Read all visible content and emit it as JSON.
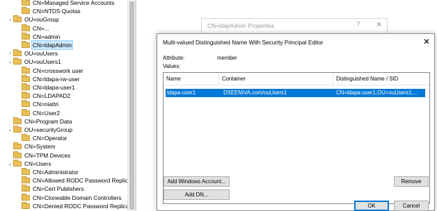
{
  "tree": {
    "nodes": [
      {
        "twisty": "",
        "label": "CN=Managed Service Accounts",
        "selected": false
      },
      {
        "twisty": "",
        "label": "CN=NTDS Quotas",
        "selected": false
      },
      {
        "twisty": "expanded",
        "label": "OU=ouGroup",
        "selected": false
      },
      {
        "twisty": "",
        "label": "CN=...",
        "selected": false
      },
      {
        "twisty": "",
        "label": "CN=admin",
        "selected": false
      },
      {
        "twisty": "",
        "label": "CN=ldapAdmin",
        "selected": true
      },
      {
        "twisty": "collapsed",
        "label": "OU=ouUsers",
        "selected": false
      },
      {
        "twisty": "expanded",
        "label": "OU=ouUsers1",
        "selected": false
      },
      {
        "twisty": "",
        "label": "CN=crosswork user",
        "selected": false
      },
      {
        "twisty": "",
        "label": "CN=ldapa-rw-user",
        "selected": false
      },
      {
        "twisty": "",
        "label": "CN=ldapa-user1",
        "selected": false
      },
      {
        "twisty": "",
        "label": "CN=LDAPAD2",
        "selected": false
      },
      {
        "twisty": "",
        "label": "CN=niattri",
        "selected": false
      },
      {
        "twisty": "",
        "label": "CN=User2",
        "selected": false
      },
      {
        "twisty": "",
        "label": "CN=Program Data",
        "selected": false
      },
      {
        "twisty": "expanded",
        "label": "OU=securityGroup",
        "selected": false
      },
      {
        "twisty": "",
        "label": "CN=Operator",
        "selected": false
      },
      {
        "twisty": "",
        "label": "CN=System",
        "selected": false
      },
      {
        "twisty": "",
        "label": "CN=TPM Devices",
        "selected": false
      },
      {
        "twisty": "expanded",
        "label": "CN=Users",
        "selected": false
      },
      {
        "twisty": "",
        "label": "CN=Administrator",
        "selected": false
      },
      {
        "twisty": "",
        "label": "CN=Allowed RODC Password Replicat",
        "selected": false
      },
      {
        "twisty": "",
        "label": "CN=Cert Publishers",
        "selected": false
      },
      {
        "twisty": "",
        "label": "CN=Cloneable Domain Controllers",
        "selected": false
      },
      {
        "twisty": "",
        "label": "CN=Denied RODC Password Replicati",
        "selected": false
      }
    ]
  },
  "bg_dialog": {
    "title": "CN=ldapAdmin Properties",
    "help": "?",
    "close": "✕"
  },
  "dialog": {
    "title": "Multi-valued Distinguished Name With Security Principal Editor",
    "close": "✕",
    "attribute_label": "Attribute:",
    "attribute_value": "member",
    "values_label": "Values:",
    "columns": [
      "Name",
      "Container",
      "Distinguished Name / SID"
    ],
    "rows": [
      {
        "name": "ldapa-user1",
        "container": "DSEENIVA.com/ouUsers1",
        "dn": "CN=ldapa-user1,OU=ouUsers1,..."
      }
    ],
    "buttons": {
      "add_windows_account": "Add Windows Account...",
      "add_dn": "Add DN...",
      "remove": "Remove",
      "ok": "OK",
      "cancel": "Cancel"
    }
  },
  "colors": {
    "selection": "#0078d7",
    "tree_selection": "#cce8ff",
    "folder": "#e8bf5a"
  }
}
